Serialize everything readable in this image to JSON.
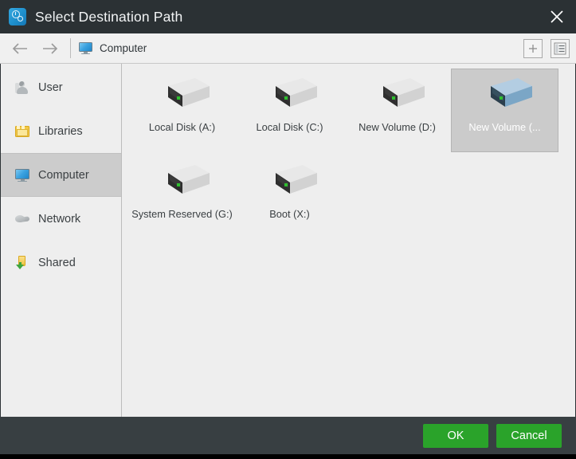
{
  "window": {
    "title": "Select Destination Path",
    "app_icon": "clock-gear-icon",
    "close_icon": "close-icon"
  },
  "nav": {
    "back_icon": "arrow-left-icon",
    "forward_icon": "arrow-right-icon",
    "breadcrumb_icon": "computer-monitor-icon",
    "breadcrumb_label": "Computer",
    "new_folder_icon": "plus-icon",
    "view_list_icon": "list-view-icon"
  },
  "sidebar": {
    "items": [
      {
        "label": "User",
        "icon": "user-icon",
        "selected": false
      },
      {
        "label": "Libraries",
        "icon": "libraries-folder-icon",
        "selected": false
      },
      {
        "label": "Computer",
        "icon": "computer-monitor-icon",
        "selected": true
      },
      {
        "label": "Network",
        "icon": "network-globe-icon",
        "selected": false
      },
      {
        "label": "Shared",
        "icon": "shared-folder-icon",
        "selected": false
      }
    ]
  },
  "content": {
    "drives": [
      {
        "label": "Local Disk (A:)",
        "icon": "hard-drive-icon",
        "selected": false
      },
      {
        "label": "Local Disk (C:)",
        "icon": "hard-drive-icon",
        "selected": false
      },
      {
        "label": "New Volume (D:)",
        "icon": "hard-drive-icon",
        "selected": false
      },
      {
        "label": "New Volume (...",
        "icon": "hard-drive-icon",
        "selected": true
      },
      {
        "label": "System Reserved (G:)",
        "icon": "hard-drive-icon",
        "selected": false
      },
      {
        "label": "Boot (X:)",
        "icon": "hard-drive-icon",
        "selected": false
      }
    ]
  },
  "footer": {
    "ok_label": "OK",
    "cancel_label": "Cancel"
  },
  "colors": {
    "titlebar": "#2b3134",
    "window_chrome": "#383f42",
    "content_bg": "#eeeeee",
    "sidebar_selected": "#cccccc",
    "item_selected": "#cbcbcb",
    "accent_green": "#2aa32a",
    "drive_led_green": "#2fbf2f",
    "drive_selected_blue": "#8fb5d4"
  }
}
